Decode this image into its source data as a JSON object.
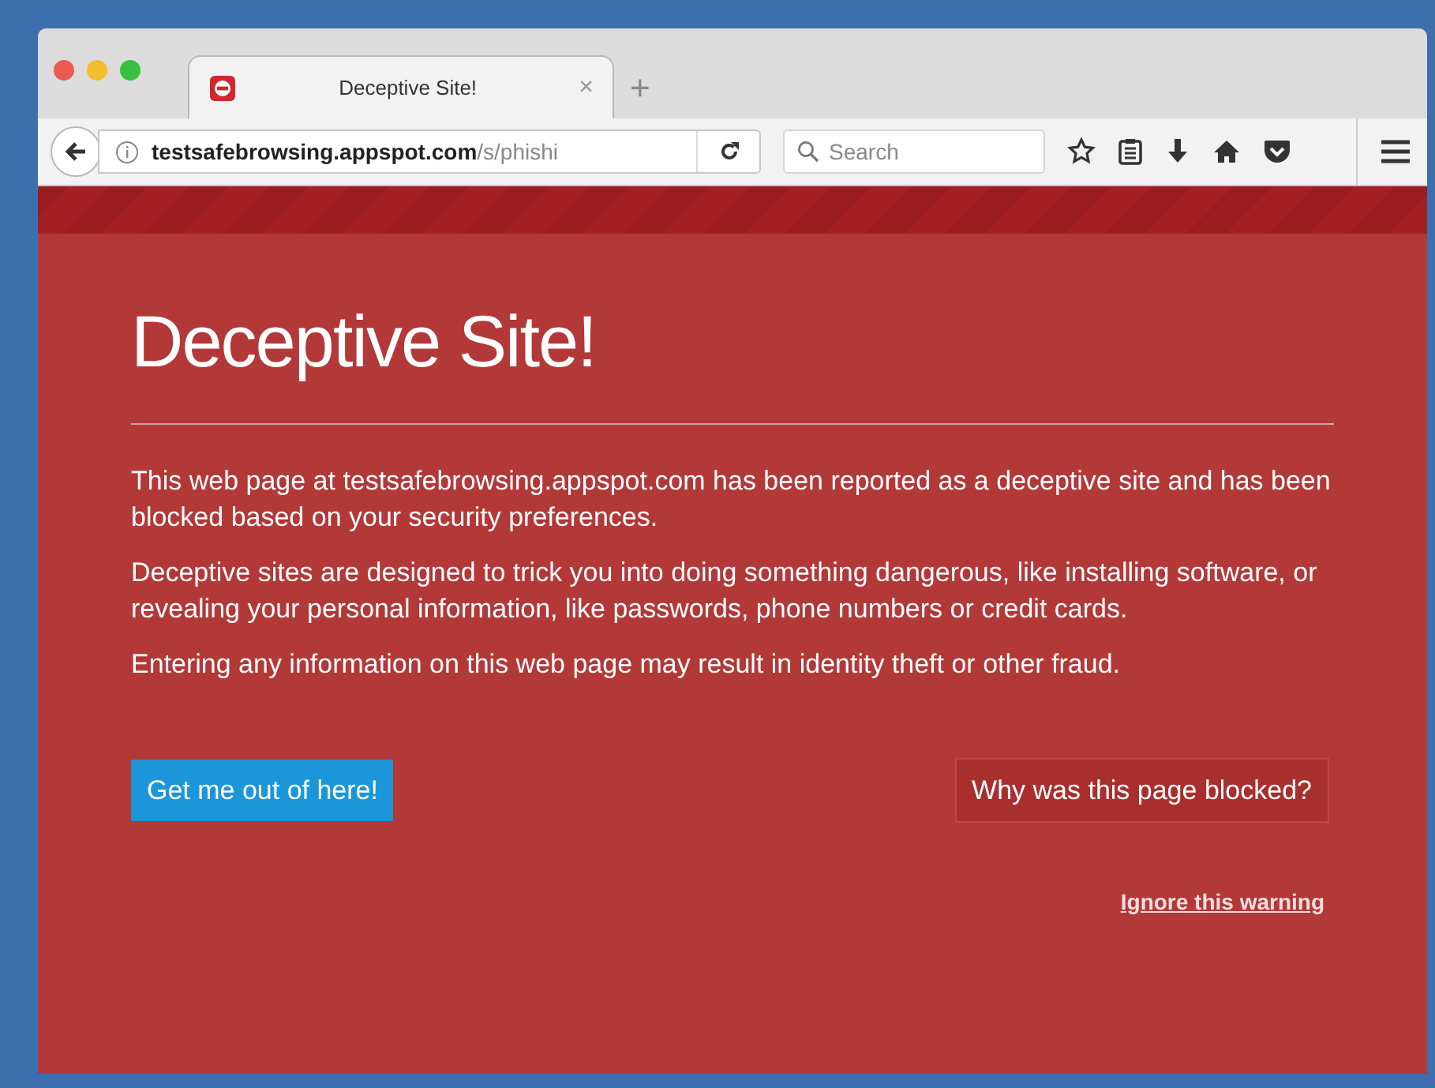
{
  "tab": {
    "title": "Deceptive Site!",
    "close": "×"
  },
  "new_tab": "+",
  "address": {
    "domain": "testsafebrowsing.appspot.com",
    "path": "/s/phishi"
  },
  "search": {
    "placeholder": "Search"
  },
  "page": {
    "heading": "Deceptive Site!",
    "paragraphs": [
      "This web page at testsafebrowsing.appspot.com has been reported as a deceptive site and has been blocked based on your security preferences.",
      "Deceptive sites are designed to trick you into doing something dangerous, like installing software, or revealing your personal information, like passwords, phone numbers or credit cards.",
      "Entering any information on this web page may result in identity theft or other fraud."
    ],
    "primary_button": "Get me out of here!",
    "secondary_button": "Why was this page blocked?",
    "ignore_link": "Ignore this warning"
  }
}
